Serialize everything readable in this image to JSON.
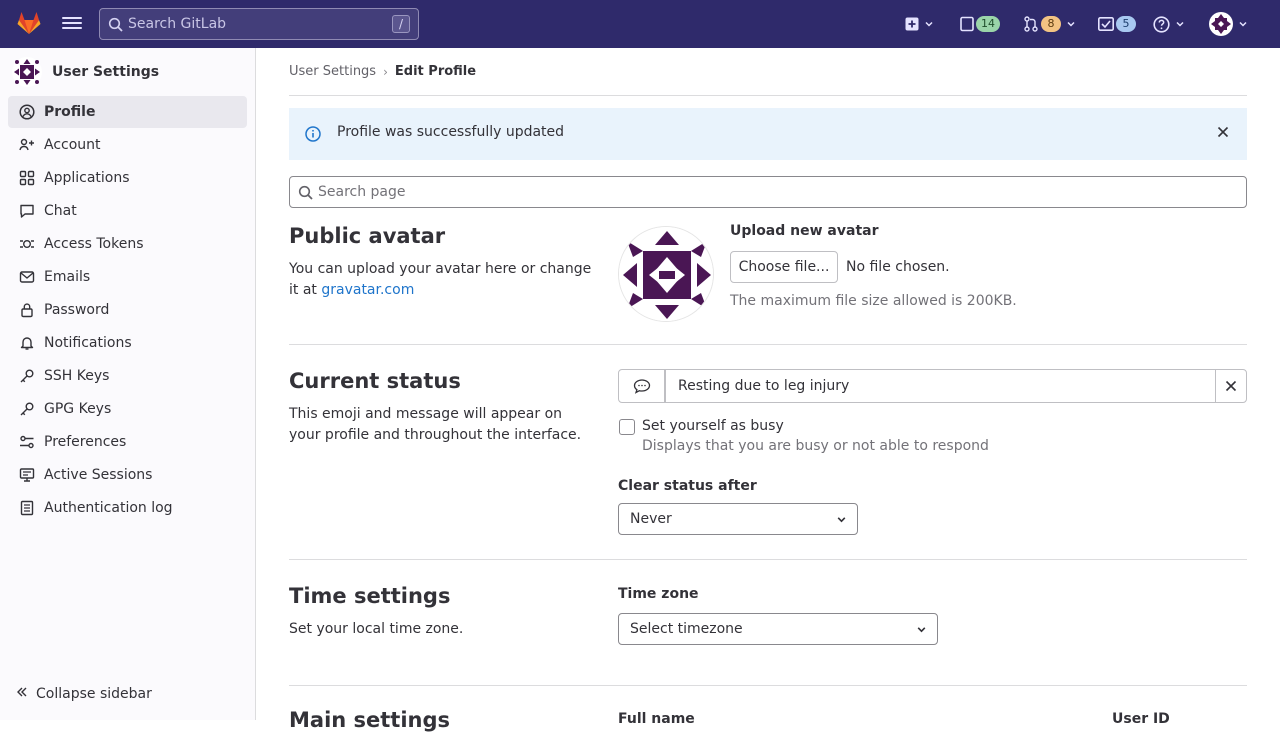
{
  "topbar": {
    "search_placeholder": "Search GitLab",
    "search_shortcut": "/",
    "issues_count": "14",
    "merge_requests_count": "8",
    "todos_count": "5"
  },
  "sidebar": {
    "title": "User Settings",
    "items": [
      {
        "label": "Profile",
        "icon": "profile-icon",
        "active": true
      },
      {
        "label": "Account",
        "icon": "account-icon"
      },
      {
        "label": "Applications",
        "icon": "applications-icon"
      },
      {
        "label": "Chat",
        "icon": "chat-icon"
      },
      {
        "label": "Access Tokens",
        "icon": "token-icon"
      },
      {
        "label": "Emails",
        "icon": "mail-icon"
      },
      {
        "label": "Password",
        "icon": "lock-icon"
      },
      {
        "label": "Notifications",
        "icon": "bell-icon"
      },
      {
        "label": "SSH Keys",
        "icon": "key-icon"
      },
      {
        "label": "GPG Keys",
        "icon": "key-icon"
      },
      {
        "label": "Preferences",
        "icon": "preferences-icon"
      },
      {
        "label": "Active Sessions",
        "icon": "monitor-icon"
      },
      {
        "label": "Authentication log",
        "icon": "log-icon"
      }
    ],
    "collapse_label": "Collapse sidebar"
  },
  "breadcrumb": {
    "parent": "User Settings",
    "current": "Edit Profile"
  },
  "alert": {
    "message": "Profile was successfully updated"
  },
  "page_search": {
    "placeholder": "Search page"
  },
  "avatar_section": {
    "title": "Public avatar",
    "description": "You can upload your avatar here or change it at",
    "link": "gravatar.com",
    "upload_label": "Upload new avatar",
    "choose_button": "Choose file...",
    "no_file": "No file chosen.",
    "max_size_help": "The maximum file size allowed is 200KB."
  },
  "status_section": {
    "title": "Current status",
    "description": "This emoji and message will appear on your profile and throughout the interface.",
    "status_value": "Resting due to leg injury",
    "busy_label": "Set yourself as busy",
    "busy_help": "Displays that you are busy or not able to respond",
    "clear_label": "Clear status after",
    "clear_value": "Never"
  },
  "time_section": {
    "title": "Time settings",
    "description": "Set your local time zone.",
    "timezone_label": "Time zone",
    "timezone_value": "Select timezone"
  },
  "main_section": {
    "title": "Main settings",
    "full_name_label": "Full name",
    "user_id_label": "User ID"
  },
  "colors": {
    "topbar": "#2f2a6b",
    "link": "#1f75cb",
    "alert_bg": "#e9f3fc",
    "avatar": "#4a1654"
  }
}
